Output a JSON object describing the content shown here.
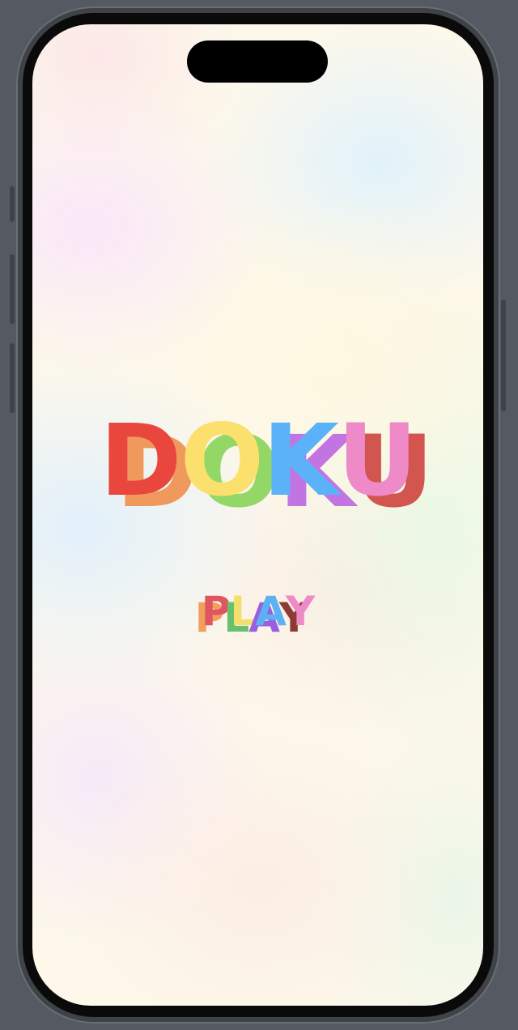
{
  "title": {
    "letters": [
      {
        "char": "D",
        "front_color": "#e9473d",
        "shadow_color": "#f0995c"
      },
      {
        "char": "O",
        "front_color": "#fbe06e",
        "shadow_color": "#93d866"
      },
      {
        "char": "K",
        "front_color": "#5cb2f8",
        "shadow_color": "#c275e2"
      },
      {
        "char": "U",
        "front_color": "#ee8ac8",
        "shadow_color": "#d25550"
      }
    ]
  },
  "play_button": {
    "letters": [
      {
        "char": "P",
        "front_color": "#e0555f",
        "shadow_color": "#f0a05c"
      },
      {
        "char": "L",
        "front_color": "#f4de6e",
        "shadow_color": "#66c06c"
      },
      {
        "char": "A",
        "front_color": "#5cb0f4",
        "shadow_color": "#9a5ee0"
      },
      {
        "char": "Y",
        "front_color": "#ee8ac8",
        "shadow_color": "#8c3a34"
      }
    ]
  }
}
